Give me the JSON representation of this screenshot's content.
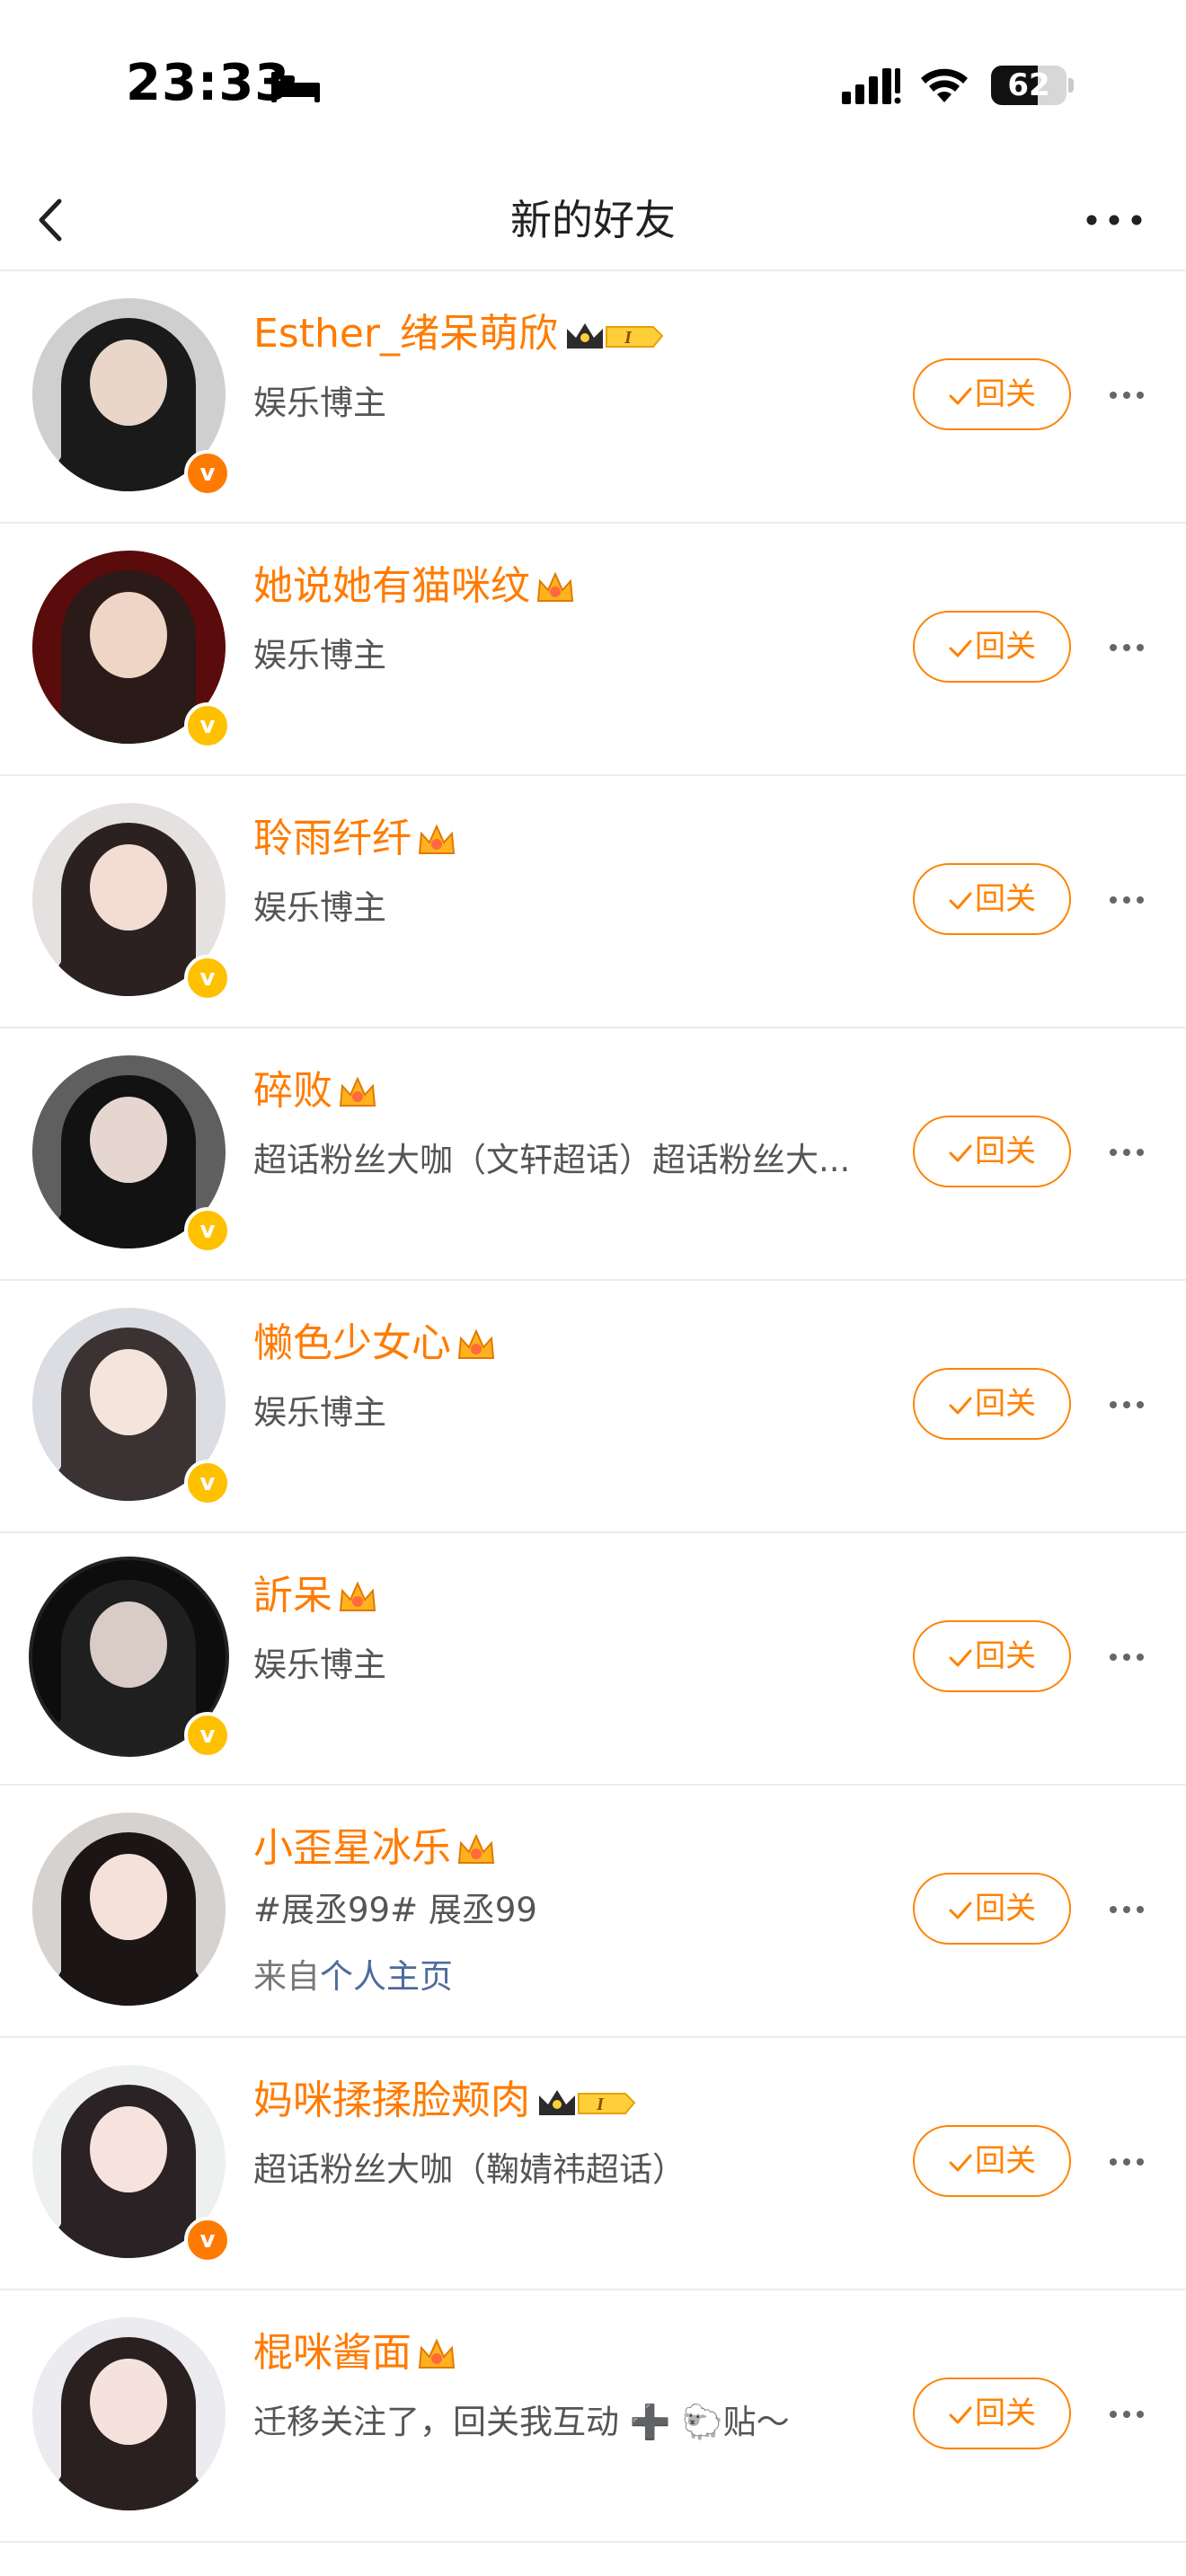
{
  "status_bar": {
    "time": "23:33",
    "battery": "62",
    "battery_level": 0.62
  },
  "nav": {
    "title": "新的好友"
  },
  "follow_label": "回关",
  "users": [
    {
      "name": "Esther_绪呆萌欣",
      "desc": "娱乐博主",
      "badge_color": "orange",
      "crown": "crown-level-1-icon",
      "palette": [
        "#cfcfcf",
        "#1a1a1a",
        "#e9d6c8"
      ]
    },
    {
      "name": "她说她有猫咪纹",
      "desc": "娱乐博主",
      "badge_color": "yellow",
      "crown": "crown-gold-icon",
      "palette": [
        "#5a0b0b",
        "#2a1a18",
        "#efd5c6"
      ]
    },
    {
      "name": "聆雨纤纤",
      "desc": "娱乐博主",
      "badge_color": "yellow",
      "crown": "crown-gold-icon",
      "palette": [
        "#e6e1e1",
        "#2b2121",
        "#f3dcd3"
      ]
    },
    {
      "name": "碎败",
      "desc": "超话粉丝大咖（文轩超话）超话粉丝大...",
      "badge_color": "yellow",
      "crown": "crown-gold-icon",
      "palette": [
        "#5f5f5f",
        "#121212",
        "#e5d7cf"
      ]
    },
    {
      "name": "懒色少女心",
      "desc": "娱乐博主",
      "badge_color": "yellow",
      "crown": "crown-gold-icon",
      "palette": [
        "#dcdde2",
        "#3b3333",
        "#f4e4dc"
      ]
    },
    {
      "name": "訢呆",
      "desc": "娱乐博主",
      "badge_color": "yellow",
      "crown": "crown-gold-icon",
      "palette": [
        "#0d0d0d",
        "#1f1f1f",
        "#d9cbc6"
      ]
    },
    {
      "name": "小歪星冰乐",
      "desc": "#展丞99# 展丞99",
      "source_prefix": "来自",
      "source_link": "个人主页",
      "badge_color": "",
      "crown": "crown-gold-icon",
      "palette": [
        "#d6d2d0",
        "#1c1515",
        "#f6e1da"
      ]
    },
    {
      "name": "妈咪揉揉脸颊肉",
      "desc": "超话粉丝大咖（鞠婧祎超话）",
      "badge_color": "orange",
      "crown": "crown-level-1-icon",
      "palette": [
        "#eef0ef",
        "#2a2224",
        "#f7e3dd"
      ]
    },
    {
      "name": "棍咪酱面",
      "desc": "迁移关注了，回关我互动 ➕ 🐑贴～",
      "badge_color": "",
      "crown": "crown-gold-icon",
      "palette": [
        "#ecebef",
        "#2b2020",
        "#f6e2dc"
      ]
    }
  ]
}
